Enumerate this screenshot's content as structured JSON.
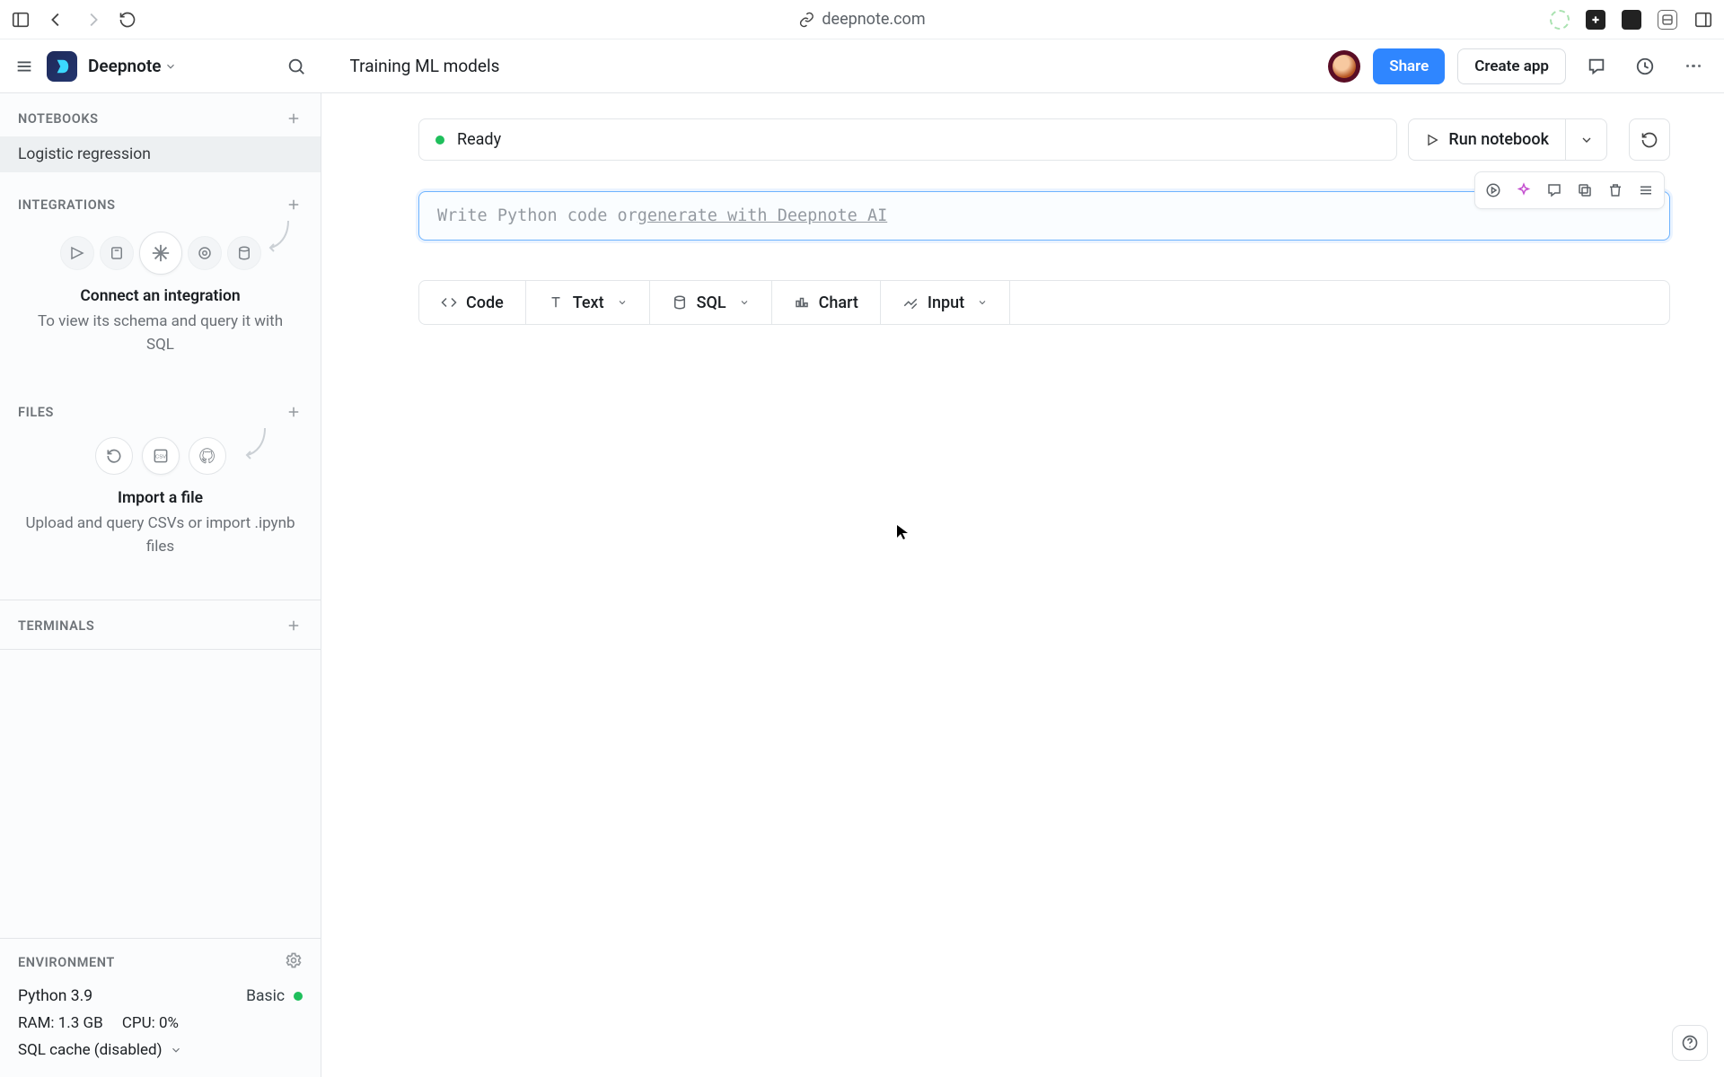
{
  "browser": {
    "url": "deepnote.com"
  },
  "header": {
    "workspace": "Deepnote",
    "document_title": "Training ML models",
    "share_label": "Share",
    "create_app_label": "Create app"
  },
  "sidebar": {
    "sections": {
      "notebooks": {
        "label": "NOTEBOOKS"
      },
      "integrations": {
        "label": "INTEGRATIONS"
      },
      "files": {
        "label": "FILES"
      },
      "terminals": {
        "label": "TERMINALS"
      },
      "environment": {
        "label": "ENVIRONMENT"
      }
    },
    "notebooks": [
      {
        "label": "Logistic regression",
        "active": true
      }
    ],
    "integrations": {
      "title": "Connect an integration",
      "subtitle": "To view its schema and query it with SQL"
    },
    "files": {
      "title": "Import a file",
      "subtitle": "Upload and query CSVs or import .ipynb files"
    },
    "environment": {
      "python": "Python 3.9",
      "tier": "Basic",
      "ram_label": "RAM: 1.3 GB",
      "cpu_label": "CPU: 0%",
      "sql_cache": "SQL cache (disabled)"
    }
  },
  "canvas": {
    "status": "Ready",
    "run_label": "Run notebook",
    "cell_placeholder_pre": "Write Python code or ",
    "cell_placeholder_ai": "generate with Deepnote AI",
    "add_buttons": {
      "code": "Code",
      "text": "Text",
      "sql": "SQL",
      "chart": "Chart",
      "input": "Input"
    }
  }
}
